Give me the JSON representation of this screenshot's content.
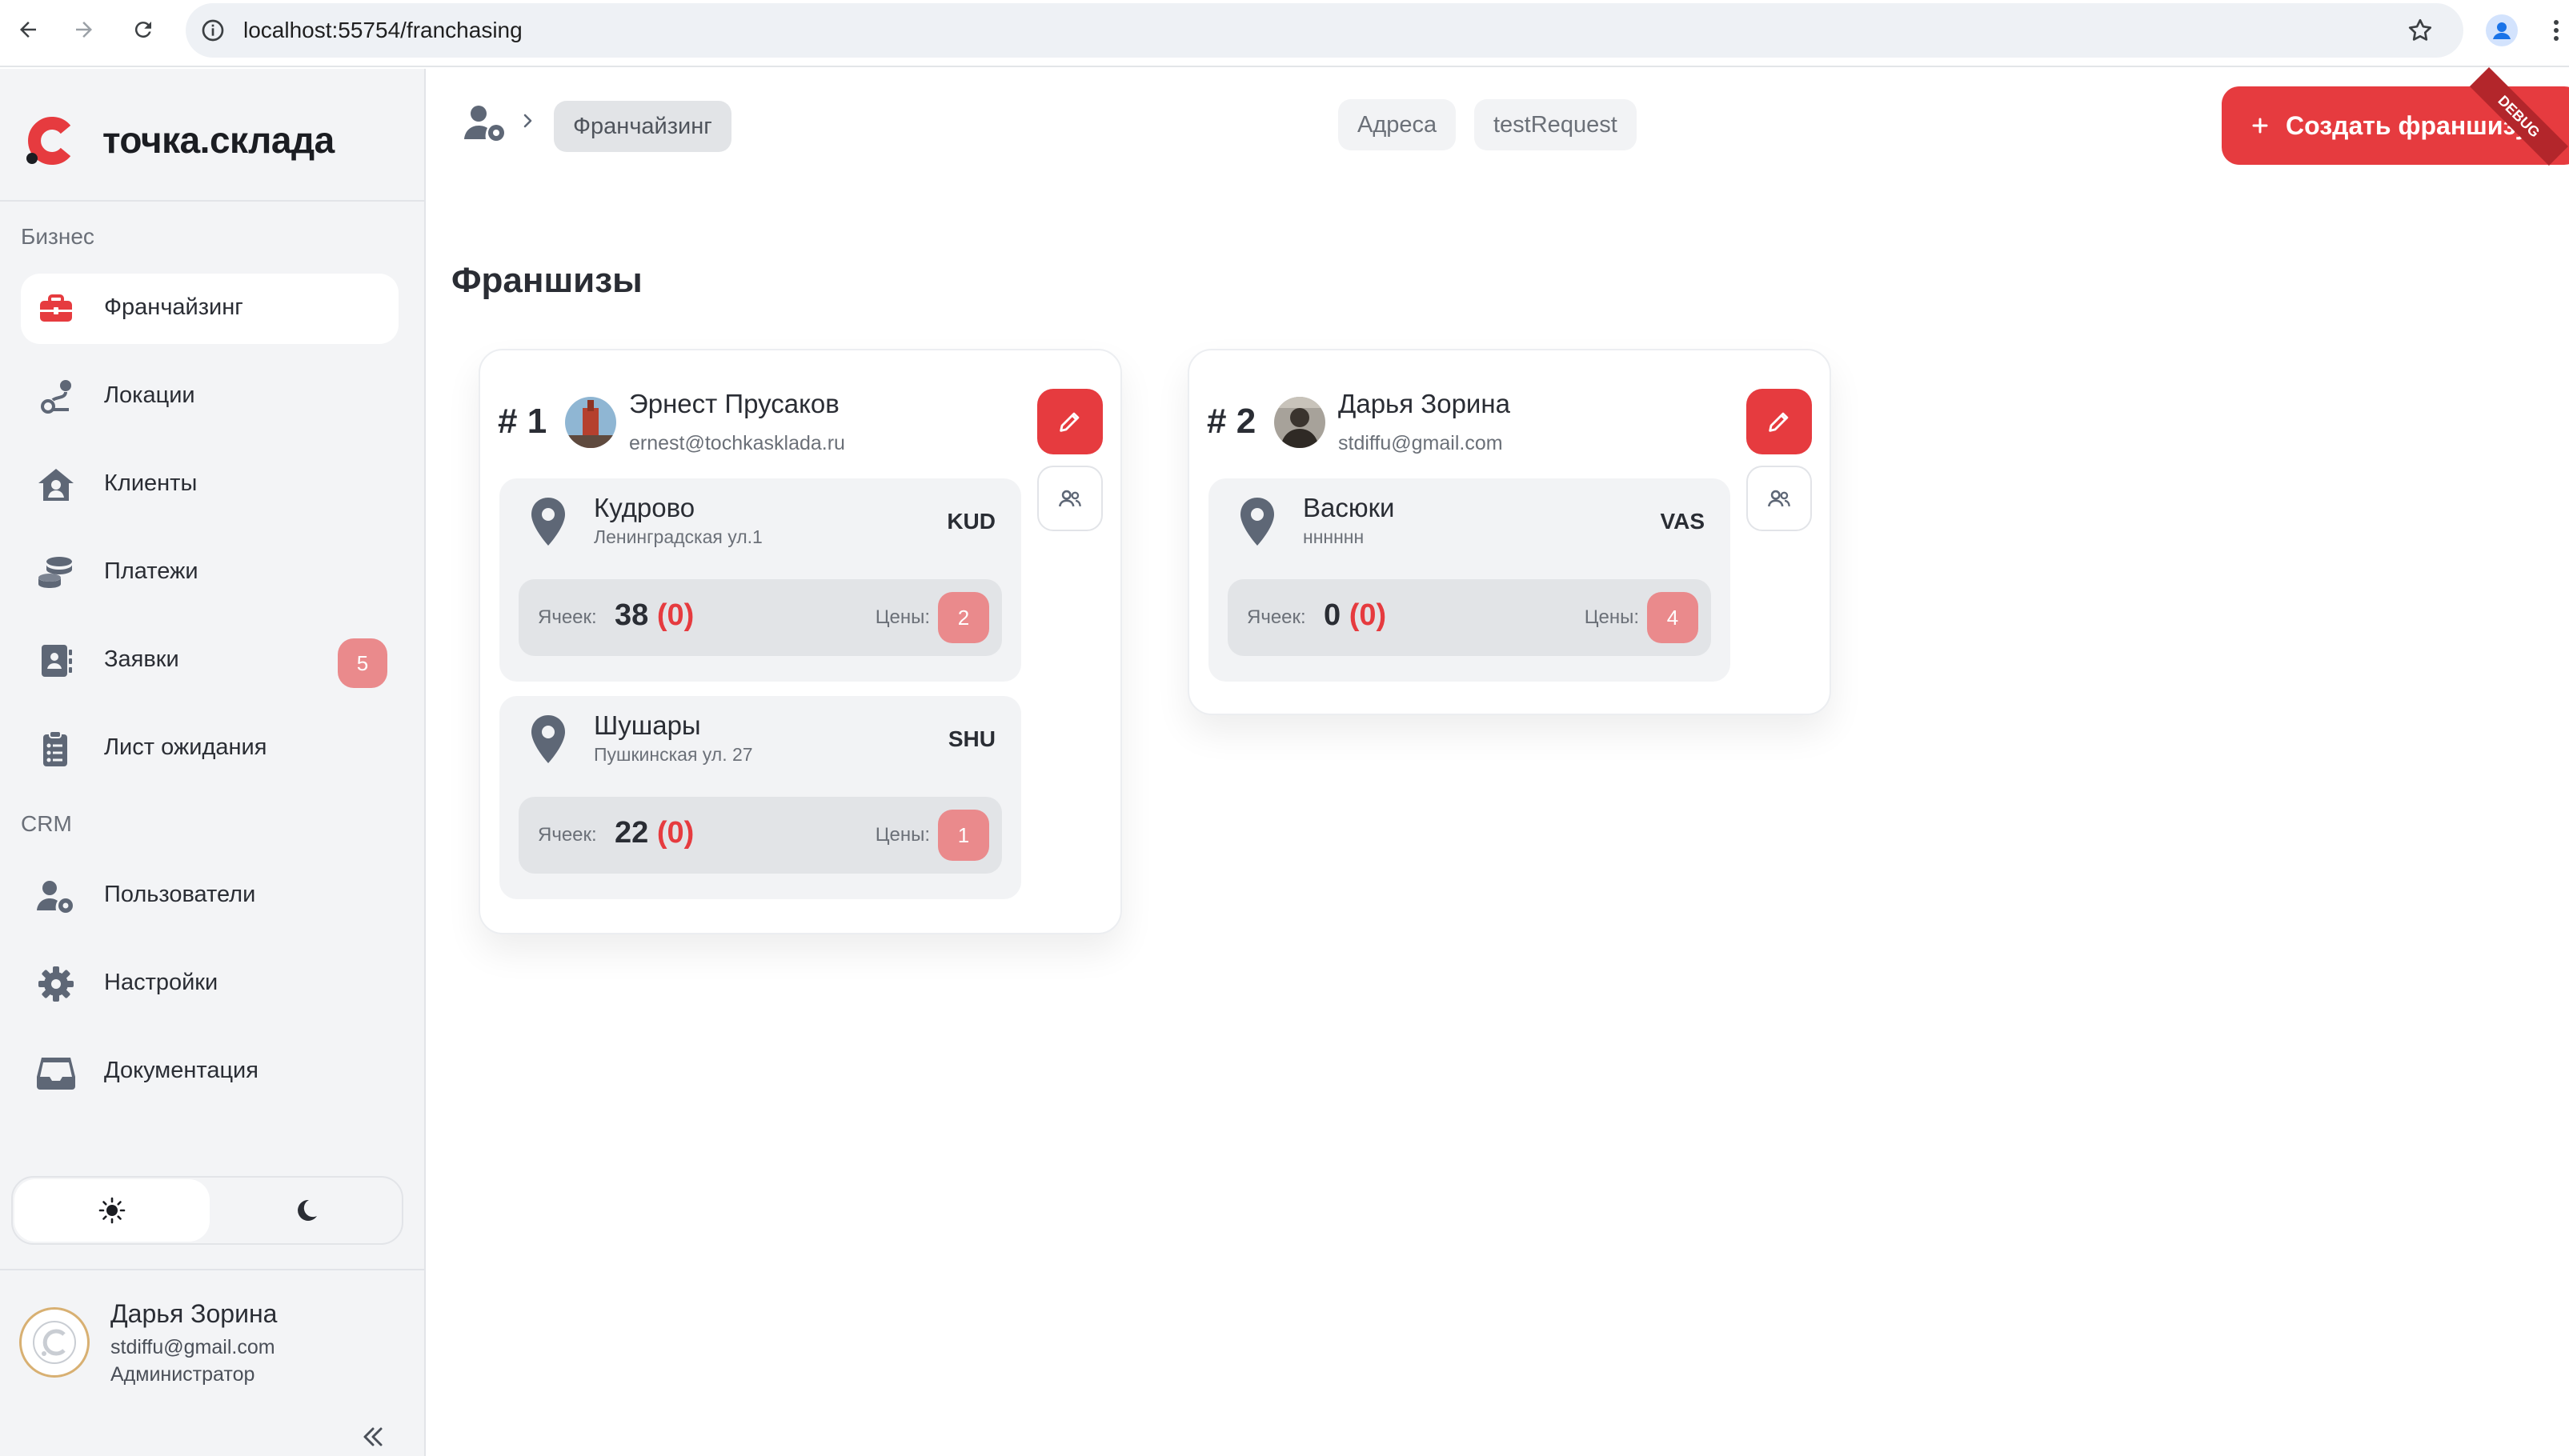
{
  "browser": {
    "url": "localhost:55754/franchasing"
  },
  "sidebar": {
    "brand": "точка.склада",
    "sections": [
      {
        "title": "Бизнес",
        "items": [
          {
            "label": "Франчайзинг",
            "icon": "briefcase-icon",
            "active": true
          },
          {
            "label": "Локации",
            "icon": "route-icon"
          },
          {
            "label": "Клиенты",
            "icon": "house-user-icon"
          },
          {
            "label": "Платежи",
            "icon": "coins-icon"
          },
          {
            "label": "Заявки",
            "icon": "contact-book-icon",
            "badge": "5"
          },
          {
            "label": "Лист ожидания",
            "icon": "clipboard-list-icon"
          }
        ]
      },
      {
        "title": "CRM",
        "items": [
          {
            "label": "Пользователи",
            "icon": "users-cog-icon"
          },
          {
            "label": "Настройки",
            "icon": "gear-icon"
          },
          {
            "label": "Документация",
            "icon": "inbox-icon"
          }
        ]
      }
    ],
    "theme": {
      "selected": "light"
    },
    "user": {
      "name": "Дарья Зорина",
      "email": "stdiffu@gmail.com",
      "role": "Администратор"
    }
  },
  "header": {
    "breadcrumb_current": "Франчайзинг",
    "chips": [
      "Адреса",
      "testRequest"
    ],
    "create_label": "Создать франшизу",
    "debug_banner": "DEBUG"
  },
  "page": {
    "title": "Франшизы",
    "cells_label": "Ячеек:",
    "prices_label": "Цены:",
    "franchises": [
      {
        "number": "# 1",
        "owner_name": "Эрнест Прусаков",
        "owner_email": "ernest@tochkasklada.ru",
        "locations": [
          {
            "name": "Кудрово",
            "address": "Ленинградская ул.1",
            "code": "KUD",
            "cells": "38",
            "cells_extra": "(0)",
            "prices": "2"
          },
          {
            "name": "Шушары",
            "address": "Пушкинская ул. 27",
            "code": "SHU",
            "cells": "22",
            "cells_extra": "(0)",
            "prices": "1"
          }
        ]
      },
      {
        "number": "# 2",
        "owner_name": "Дарья Зорина",
        "owner_email": "stdiffu@gmail.com",
        "locations": [
          {
            "name": "Васюки",
            "address": "нннннн",
            "code": "VAS",
            "cells": "0",
            "cells_extra": "(0)",
            "prices": "4"
          }
        ]
      }
    ]
  },
  "colors": {
    "accent": "#e63b3f",
    "badge": "#ea8a8c",
    "icon": "#5e6776"
  }
}
